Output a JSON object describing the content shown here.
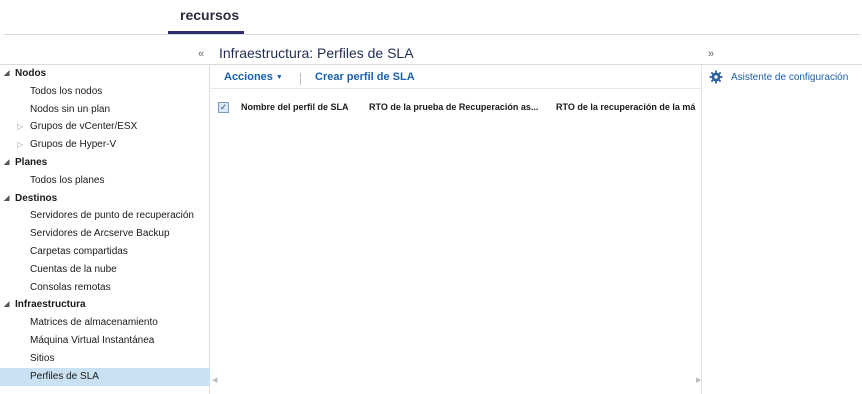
{
  "top_tab": {
    "label": "recursos"
  },
  "panel": {
    "title": "Infraestructura: Perfiles de SLA"
  },
  "chevrons": {
    "left": "«",
    "right": "»"
  },
  "sidebar": {
    "groups": [
      {
        "label": "Nodos",
        "items": [
          {
            "label": "Todos los nodos"
          },
          {
            "label": "Nodos sin un plan"
          },
          {
            "label": "Grupos de vCenter/ESX",
            "collapsed": true
          },
          {
            "label": "Grupos de Hyper-V",
            "collapsed": true
          }
        ]
      },
      {
        "label": "Planes",
        "items": [
          {
            "label": "Todos los planes"
          }
        ]
      },
      {
        "label": "Destinos",
        "items": [
          {
            "label": "Servidores de punto de recuperación"
          },
          {
            "label": "Servidores de Arcserve Backup"
          },
          {
            "label": "Carpetas compartidas"
          },
          {
            "label": "Cuentas de la nube"
          },
          {
            "label": "Consolas remotas"
          }
        ]
      },
      {
        "label": "Infraestructura",
        "items": [
          {
            "label": "Matrices de almacenamiento"
          },
          {
            "label": "Máquina Virtual Instantánea"
          },
          {
            "label": "Sitios"
          },
          {
            "label": "Perfiles de SLA",
            "selected": true
          }
        ]
      }
    ]
  },
  "toolbar": {
    "actions_label": "Acciones",
    "create_label": "Crear perfil de SLA"
  },
  "table": {
    "select_all_checked": true,
    "columns": [
      "Nombre del perfil de SLA",
      "RTO de la prueba de Recuperación as...",
      "RTO de la recuperación de la má"
    ],
    "rows": []
  },
  "right_rail": {
    "wizard_label": "Asistente de configuración"
  },
  "colors": {
    "accent": "#1b5fa8",
    "selected_row": "#c9e1f2",
    "tab_underline": "#2e2e6e"
  }
}
